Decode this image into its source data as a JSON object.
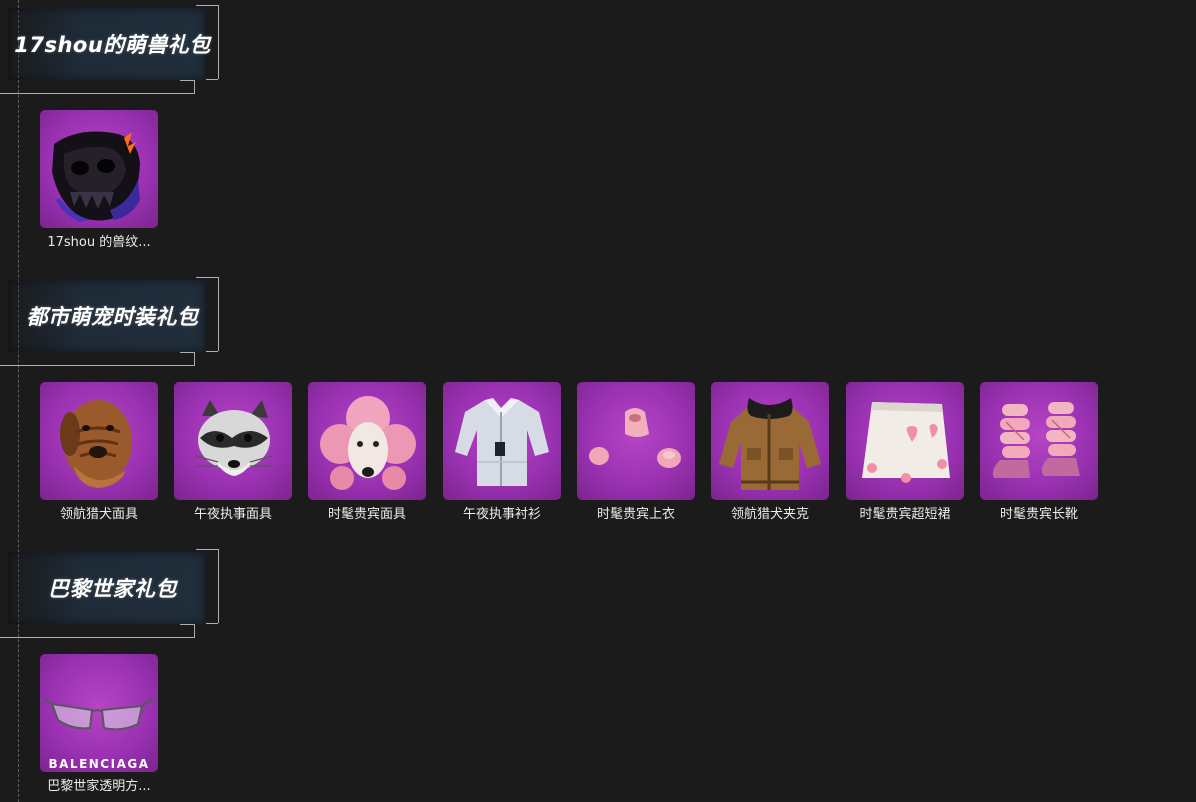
{
  "sections": [
    {
      "title": "17shou的萌兽礼包",
      "items": [
        {
          "label": "17shou 的兽纹...",
          "icon": "skull-mask-icon"
        }
      ]
    },
    {
      "title": "都市萌宠时装礼包",
      "items": [
        {
          "label": "领航猎犬面具",
          "icon": "dog-mask-icon"
        },
        {
          "label": "午夜执事面具",
          "icon": "raccoon-mask-icon"
        },
        {
          "label": "时髦贵宾面具",
          "icon": "poodle-mask-icon"
        },
        {
          "label": "午夜执事衬衫",
          "icon": "shirt-icon"
        },
        {
          "label": "时髦贵宾上衣",
          "icon": "pink-top-icon"
        },
        {
          "label": "领航猎犬夹克",
          "icon": "jacket-icon"
        },
        {
          "label": "时髦贵宾超短裙",
          "icon": "skirt-icon"
        },
        {
          "label": "时髦贵宾长靴",
          "icon": "boots-icon"
        }
      ]
    },
    {
      "title": "巴黎世家礼包",
      "items": [
        {
          "label": "巴黎世家透明方...",
          "icon": "glasses-icon",
          "brand": "BALENCIAGA"
        }
      ]
    }
  ],
  "colors": {
    "background": "#1b1b1c",
    "tile": "#9b32b3",
    "header_box": "#1f2b38"
  }
}
